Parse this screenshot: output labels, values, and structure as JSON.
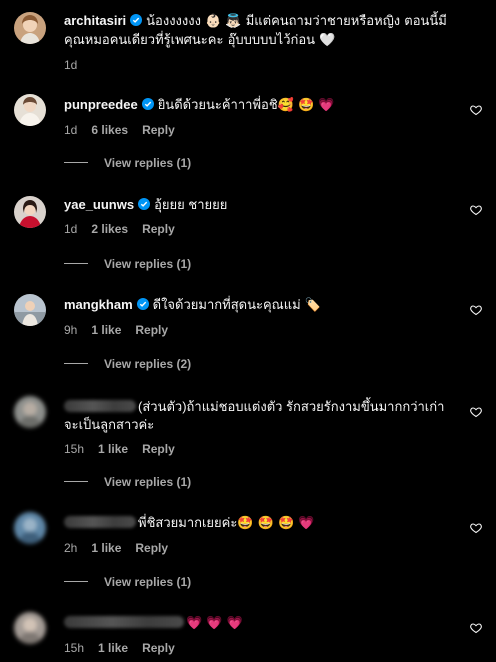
{
  "comments": [
    {
      "username": "architasiri",
      "verified": true,
      "text": "น้องงงงงง 👶🏻 👼🏻 มีแต่คนถามว่าชายหรือหญิง ตอนนี้มีคุณหมอคนเดียวที่รู้เพศนะคะ อุ๊บบบบบไว้ก่อน 🤍",
      "time": "1d",
      "likes": "",
      "reply_label": "",
      "has_heart": false
    },
    {
      "username": "punpreedee",
      "verified": true,
      "text": "ยินดีด้วยนะค้าาาพี่อชิ🥰 🤩 💗",
      "time": "1d",
      "likes": "6 likes",
      "reply_label": "Reply",
      "has_heart": true,
      "view_replies": "View replies (1)"
    },
    {
      "username": "yae_uunws",
      "verified": true,
      "text": "อุ้ยยย ชายยย",
      "time": "1d",
      "likes": "2 likes",
      "reply_label": "Reply",
      "has_heart": true,
      "view_replies": "View replies (1)"
    },
    {
      "username": "mangkham",
      "verified": true,
      "text": "ดีใจด้วยมากที่สุดนะคุณแม่ 🏷️",
      "time": "9h",
      "likes": "1 like",
      "reply_label": "Reply",
      "has_heart": true,
      "view_replies": "View replies (2)"
    },
    {
      "username": "",
      "verified": false,
      "text": "(ส่วนตัว)ถ้าแม่ชอบแต่งตัว รักสวยรักงามขึ้นมากกว่าเก่าจะเป็นลูกสาวค่ะ",
      "time": "15h",
      "likes": "1 like",
      "reply_label": "Reply",
      "has_heart": true,
      "view_replies": "View replies (1)"
    },
    {
      "username": "",
      "verified": false,
      "text": "พี่ชิสวยมากเยยค่ะ🤩 🤩 🤩 💗",
      "time": "2h",
      "likes": "1 like",
      "reply_label": "Reply",
      "has_heart": true,
      "view_replies": "View replies (1)"
    },
    {
      "username": "",
      "verified": false,
      "text": "💗 💗 💗",
      "time": "15h",
      "likes": "1 like",
      "reply_label": "Reply",
      "has_heart": true
    }
  ],
  "colors": {
    "background": "#000000",
    "text": "#f5f5f5",
    "secondary": "#a8a8a8",
    "verified": "#0095f6"
  }
}
